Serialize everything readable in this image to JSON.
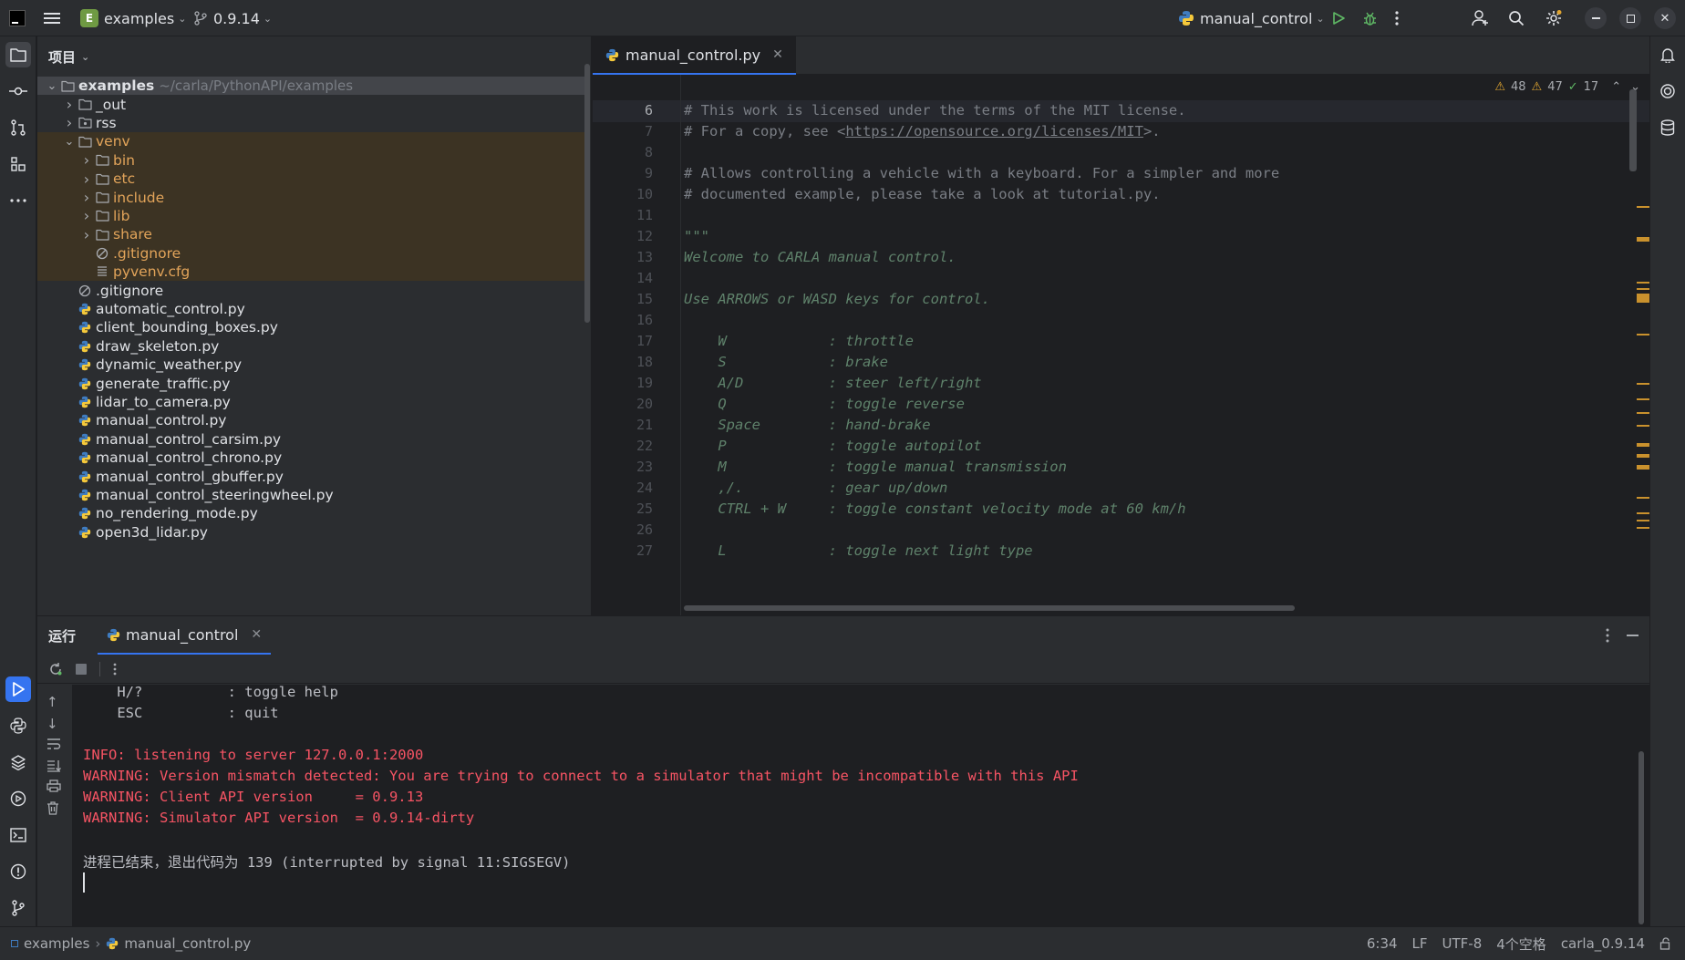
{
  "titlebar": {
    "project_badge": "E",
    "project_name": "examples",
    "branch": "0.9.14",
    "run_config": "manual_control"
  },
  "project_panel": {
    "title": "项目",
    "tree": [
      {
        "label": "examples",
        "path": "~/carla/PythonAPI/examples",
        "type": "folder",
        "expanded": true,
        "depth": 0
      },
      {
        "label": "_out",
        "type": "folder",
        "depth": 1
      },
      {
        "label": "rss",
        "type": "package",
        "depth": 1
      },
      {
        "label": "venv",
        "type": "folder",
        "expanded": true,
        "depth": 1,
        "excluded": true
      },
      {
        "label": "bin",
        "type": "folder",
        "depth": 2,
        "excluded": true
      },
      {
        "label": "etc",
        "type": "folder",
        "depth": 2,
        "excluded": true
      },
      {
        "label": "include",
        "type": "folder",
        "depth": 2,
        "excluded": true
      },
      {
        "label": "lib",
        "type": "folder",
        "depth": 2,
        "excluded": true
      },
      {
        "label": "share",
        "type": "folder",
        "depth": 2,
        "excluded": true
      },
      {
        "label": ".gitignore",
        "type": "ignore",
        "depth": 2,
        "excluded": true
      },
      {
        "label": "pyvenv.cfg",
        "type": "text",
        "depth": 2,
        "excluded": true
      },
      {
        "label": ".gitignore",
        "type": "ignore",
        "depth": 1
      },
      {
        "label": "automatic_control.py",
        "type": "python",
        "depth": 1
      },
      {
        "label": "client_bounding_boxes.py",
        "type": "python",
        "depth": 1
      },
      {
        "label": "draw_skeleton.py",
        "type": "python",
        "depth": 1
      },
      {
        "label": "dynamic_weather.py",
        "type": "python",
        "depth": 1
      },
      {
        "label": "generate_traffic.py",
        "type": "python",
        "depth": 1
      },
      {
        "label": "lidar_to_camera.py",
        "type": "python",
        "depth": 1
      },
      {
        "label": "manual_control.py",
        "type": "python",
        "depth": 1
      },
      {
        "label": "manual_control_carsim.py",
        "type": "python",
        "depth": 1
      },
      {
        "label": "manual_control_chrono.py",
        "type": "python",
        "depth": 1
      },
      {
        "label": "manual_control_gbuffer.py",
        "type": "python",
        "depth": 1
      },
      {
        "label": "manual_control_steeringwheel.py",
        "type": "python",
        "depth": 1
      },
      {
        "label": "no_rendering_mode.py",
        "type": "python",
        "depth": 1
      },
      {
        "label": "open3d_lidar.py",
        "type": "python",
        "depth": 1
      }
    ]
  },
  "editor": {
    "tab": "manual_control.py",
    "inspections": {
      "warnings": "48",
      "weak_warnings": "47",
      "typos": "17"
    },
    "lines": [
      {
        "n": "6",
        "text": "# This work is licensed under the terms of the MIT license.",
        "kind": "comment"
      },
      {
        "n": "7",
        "pre": "# For a copy, see <",
        "link": "https://opensource.org/licenses/MIT",
        "post": ">.",
        "kind": "comment"
      },
      {
        "n": "8",
        "text": "",
        "kind": "comment"
      },
      {
        "n": "9",
        "text": "# Allows controlling a vehicle with a keyboard. For a simpler and more",
        "kind": "comment"
      },
      {
        "n": "10",
        "text": "# documented example, please take a look at tutorial.py.",
        "kind": "comment"
      },
      {
        "n": "11",
        "text": "",
        "kind": "comment"
      },
      {
        "n": "12",
        "text": "\"\"\"",
        "kind": "doc"
      },
      {
        "n": "13",
        "text": "Welcome to CARLA manual control.",
        "kind": "doc"
      },
      {
        "n": "14",
        "text": "",
        "kind": "doc"
      },
      {
        "n": "15",
        "text": "Use ARROWS or WASD keys for control.",
        "kind": "doc"
      },
      {
        "n": "16",
        "text": "",
        "kind": "doc"
      },
      {
        "n": "17",
        "text": "    W            : throttle",
        "kind": "doc"
      },
      {
        "n": "18",
        "text": "    S            : brake",
        "kind": "doc"
      },
      {
        "n": "19",
        "text": "    A/D          : steer left/right",
        "kind": "doc"
      },
      {
        "n": "20",
        "text": "    Q            : toggle reverse",
        "kind": "doc"
      },
      {
        "n": "21",
        "text": "    Space        : hand-brake",
        "kind": "doc"
      },
      {
        "n": "22",
        "text": "    P            : toggle autopilot",
        "kind": "doc"
      },
      {
        "n": "23",
        "text": "    M            : toggle manual transmission",
        "kind": "doc"
      },
      {
        "n": "24",
        "text": "    ,/.          : gear up/down",
        "kind": "doc"
      },
      {
        "n": "25",
        "text": "    CTRL + W     : toggle constant velocity mode at 60 km/h",
        "kind": "doc"
      },
      {
        "n": "26",
        "text": "",
        "kind": "doc"
      },
      {
        "n": "27",
        "text": "    L            : toggle next light type",
        "kind": "doc"
      }
    ]
  },
  "run_panel": {
    "title": "运行",
    "tab": "manual_control",
    "console": [
      {
        "text": "    H/?          : toggle help",
        "kind": "normal"
      },
      {
        "text": "    ESC          : quit",
        "kind": "normal"
      },
      {
        "text": "",
        "kind": "normal"
      },
      {
        "text": "INFO: listening to server 127.0.0.1:2000",
        "kind": "err"
      },
      {
        "text": "WARNING: Version mismatch detected: You are trying to connect to a simulator that might be incompatible with this API",
        "kind": "err"
      },
      {
        "text": "WARNING: Client API version     = 0.9.13",
        "kind": "err"
      },
      {
        "text": "WARNING: Simulator API version  = 0.9.14-dirty",
        "kind": "err"
      },
      {
        "text": "",
        "kind": "normal"
      },
      {
        "text": "进程已结束，退出代码为 139 (interrupted by signal 11:SIGSEGV)",
        "kind": "normal"
      }
    ]
  },
  "statusbar": {
    "breadcrumb_root": "examples",
    "breadcrumb_file": "manual_control.py",
    "position": "6:34",
    "line_sep": "LF",
    "encoding": "UTF-8",
    "indent": "4个空格",
    "interpreter": "carla_0.9.14"
  },
  "colors": {
    "accent": "#3574f0",
    "error_text": "#f75464",
    "excluded_folder": "#e2a45a",
    "doc_string": "#5f826b",
    "comment": "#7a7e85"
  }
}
